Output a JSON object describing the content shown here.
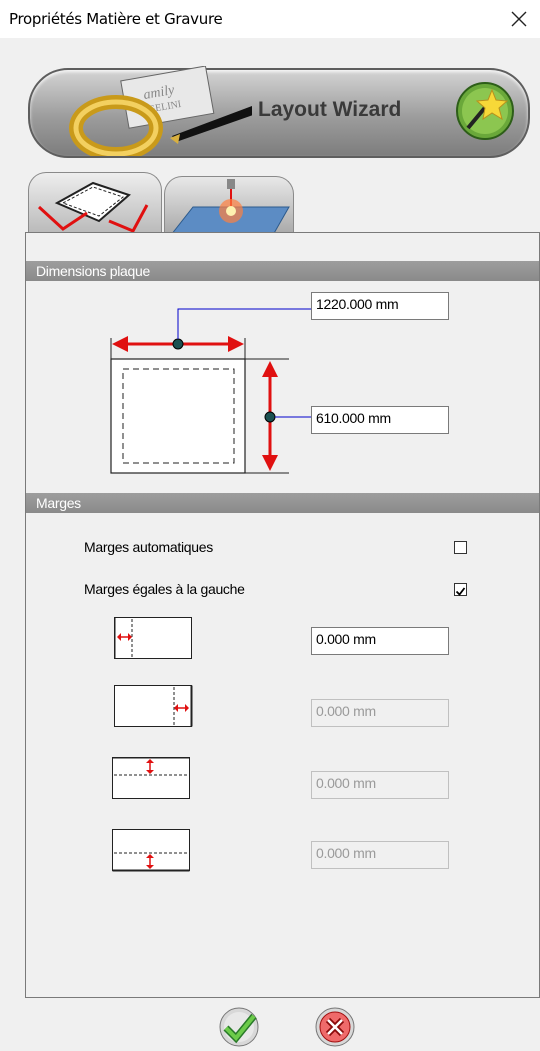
{
  "window": {
    "title": "Propriétés Matière et Gravure"
  },
  "banner": {
    "wizard_label": "Layout Wizard",
    "brand_text_1": "Family",
    "brand_text_2": "GELINI"
  },
  "tabs": [
    {
      "name": "material",
      "active": true
    },
    {
      "name": "laser",
      "active": false
    }
  ],
  "dimensions": {
    "header": "Dimensions plaque",
    "width_value": "1220.000 mm",
    "height_value": "610.000 mm"
  },
  "margins": {
    "header": "Marges",
    "auto_label": "Marges automatiques",
    "auto_checked": false,
    "equal_label": "Marges égales à la gauche",
    "equal_checked": true,
    "left_value": "0.000 mm",
    "right_value": "0.000 mm",
    "top_value": "0.000 mm",
    "bottom_value": "0.000 mm"
  },
  "colors": {
    "arrow_red": "#e01010",
    "dimension_line_blue": "#0000cc",
    "ok_green": "#3aa33a",
    "cancel_red": "#d22020"
  }
}
